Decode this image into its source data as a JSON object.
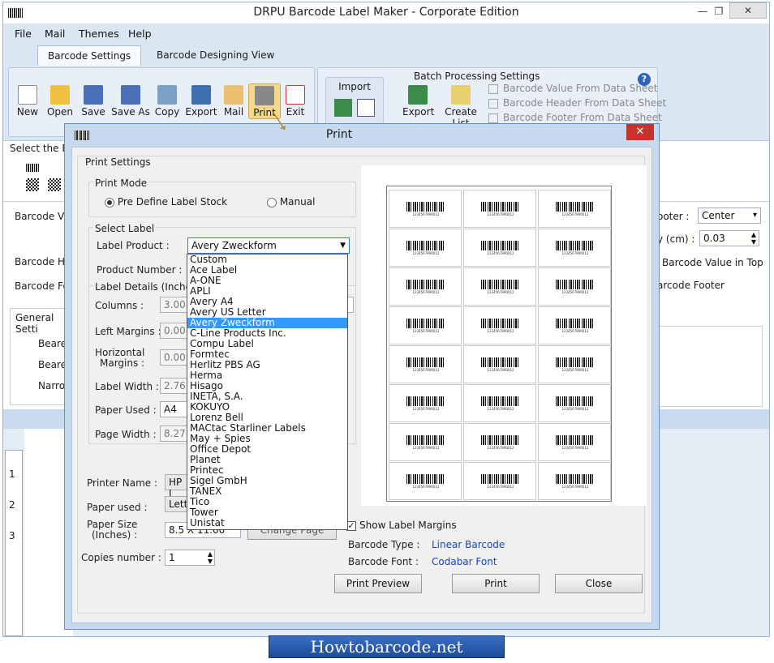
{
  "window": {
    "title": "DRPU Barcode Label Maker - Corporate Edition"
  },
  "menu": [
    "File",
    "Mail",
    "Themes",
    "Help"
  ],
  "tabs": [
    "Barcode Settings",
    "Barcode Designing View"
  ],
  "toolbar": {
    "buttons": [
      "New",
      "Open",
      "Save",
      "Save As",
      "Copy",
      "Export",
      "Mail",
      "Print",
      "Exit"
    ],
    "import_label": "Import",
    "batch_title": "Batch Processing Settings",
    "batch_buttons": [
      "Export",
      "Create List"
    ],
    "batch_options": [
      "Barcode Value From Data Sheet",
      "Barcode Header From Data Sheet",
      "Barcode Footer From Data Sheet"
    ]
  },
  "background": {
    "select_bar": "Select the Bar",
    "barcode_value": "Barcode Valu",
    "barcode_header": "Barcode Hea",
    "barcode_footer": "Barcode Foo",
    "general_settings": "General Setti",
    "bearer1": "Beare",
    "bearer2": "Beare",
    "narrow": "Narro",
    "footer_label": "ooter :",
    "footer_value": "Center",
    "cm_label": "y (cm) :",
    "cm_value": "0.03",
    "value_top": "Barcode Value in Top",
    "bc_footer": "arcode Footer",
    "ruler": [
      "1",
      "2",
      "3"
    ]
  },
  "dialog": {
    "title": "Print",
    "close_glyph": "✕",
    "print_settings": "Print Settings",
    "print_mode": "Print Mode",
    "mode_predefine": "Pre Define Label Stock",
    "mode_manual": "Manual",
    "select_label": "Select Label",
    "label_product": "Label Product :",
    "label_product_value": "Avery Zweckform",
    "product_number": "Product Number :",
    "label_details": "Label Details (Inche",
    "columns": "Columns :",
    "columns_value": "3.00",
    "left_margins": "Left Margins :",
    "left_margins_value": "0.00",
    "horizontal_margins_1": "Horizontal",
    "horizontal_margins_2": "Margins :",
    "horizontal_margins_value": "0.00",
    "label_width": "Label Width :",
    "label_width_value": "2.76",
    "paper_used": "Paper Used :",
    "paper_used_value": "A4",
    "page_width": "Page Width :",
    "page_width_value": "8.27",
    "printer_name": "Printer Name :",
    "printer_value": "HP L",
    "paper_used2": "Paper used :",
    "paper_used2_value": "Lette",
    "paper_size_1": "Paper Size",
    "paper_size_2": "(Inches) :",
    "paper_size_value": "8.5 X 11.00",
    "change_page": "Change Page",
    "copies": "Copies number :",
    "copies_value": "1",
    "show_margins": "Show Label Margins",
    "barcode_type_label": "Barcode Type :",
    "barcode_type": "Linear Barcode",
    "barcode_font_label": "Barcode Font :",
    "barcode_font": "Codabar Font",
    "btn_preview": "Print Preview",
    "btn_print": "Print",
    "btn_close": "Close",
    "label_options": [
      "Custom",
      "Ace Label",
      "A-ONE",
      "APLI",
      "Avery A4",
      "Avery US Letter",
      "Avery Zweckform",
      "C-Line Products Inc.",
      "Compu Label",
      "Formtec",
      "Herlitz PBS AG",
      "Herma",
      "Hisago",
      "INETA, S.A.",
      "KOKUYO",
      "Lorenz Bell",
      "MACtac Starliner Labels",
      "May + Spies",
      "Office Depot",
      "Planet",
      "Printec",
      "Sigel GmbH",
      "TANEX",
      "Tico",
      "Tower",
      "Unistat"
    ],
    "selected_option": "Avery Zweckform",
    "label_numbers": [
      "1234567890012",
      "1234567890012",
      "1234567890012"
    ]
  },
  "footer_brand": "Howtobarcode.net",
  "colors": {
    "accent": "#3399ff",
    "frame": "#c6d9ef",
    "close": "#c7332b",
    "link": "#1a46b8"
  }
}
